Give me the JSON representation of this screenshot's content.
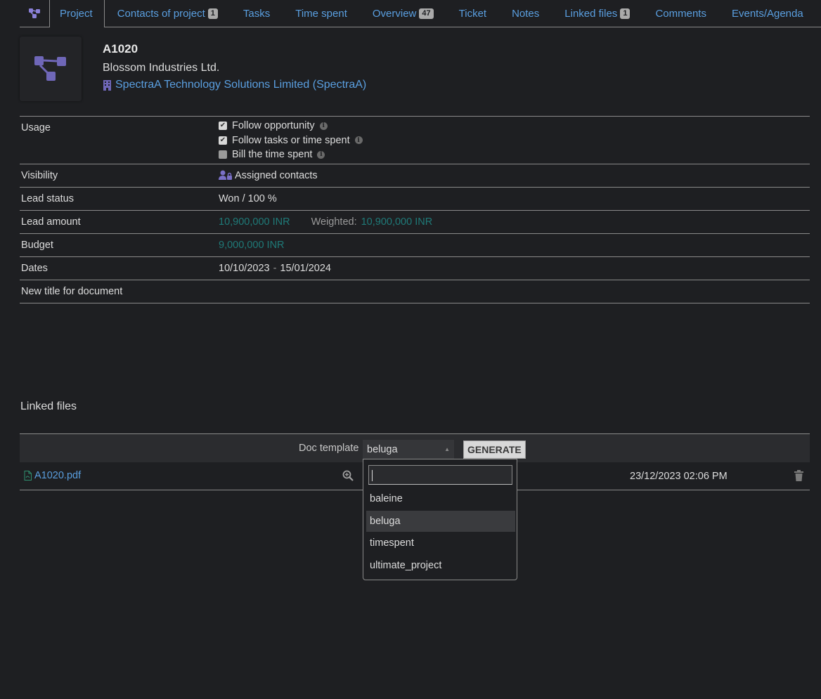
{
  "tabs": [
    {
      "label": "Project",
      "badge": ""
    },
    {
      "label": "Contacts of project",
      "badge": "1"
    },
    {
      "label": "Tasks",
      "badge": ""
    },
    {
      "label": "Time spent",
      "badge": ""
    },
    {
      "label": "Overview",
      "badge": "47"
    },
    {
      "label": "Ticket",
      "badge": ""
    },
    {
      "label": "Notes",
      "badge": ""
    },
    {
      "label": "Linked files",
      "badge": "1"
    },
    {
      "label": "Comments",
      "badge": ""
    },
    {
      "label": "Events/Agenda",
      "badge": ""
    }
  ],
  "project": {
    "ref": "A1020",
    "client": "Blossom Industries Ltd.",
    "thirdparty": "SpectraA Technology Solutions Limited (SpectraA)"
  },
  "fields": {
    "usage": {
      "label": "Usage",
      "options": [
        {
          "label": "Follow opportunity",
          "checked": true
        },
        {
          "label": "Follow tasks or time spent",
          "checked": true
        },
        {
          "label": "Bill the time spent",
          "checked": false
        }
      ]
    },
    "visibility": {
      "label": "Visibility",
      "value": "Assigned contacts"
    },
    "lead_status": {
      "label": "Lead status",
      "value": "Won / 100 %"
    },
    "lead_amount": {
      "label": "Lead amount",
      "value": "10,900,000 INR",
      "weighted_label": "Weighted:",
      "weighted_value": "10,900,000 INR"
    },
    "budget": {
      "label": "Budget",
      "value": "9,000,000 INR"
    },
    "dates": {
      "label": "Dates",
      "start": "10/10/2023",
      "sep": "-",
      "end": "15/01/2024"
    },
    "doc_title": {
      "label": "New title for document",
      "value": ""
    }
  },
  "linked_files": {
    "title": "Linked files",
    "template_label": "Doc template",
    "template_selected": "beluga",
    "generate_label": "GENERATE",
    "files": [
      {
        "name": "A1020.pdf",
        "date": "23/12/2023 02:06 PM"
      }
    ]
  },
  "dropdown": {
    "search_value": "",
    "options": [
      "baleine",
      "beluga",
      "timespent",
      "ultimate_project"
    ],
    "selected_index": 1
  },
  "colors": {
    "background": "#1e1f22",
    "link": "#5a9fe0",
    "amount": "#1f7a78",
    "icon_purple": "#7a70c8"
  }
}
